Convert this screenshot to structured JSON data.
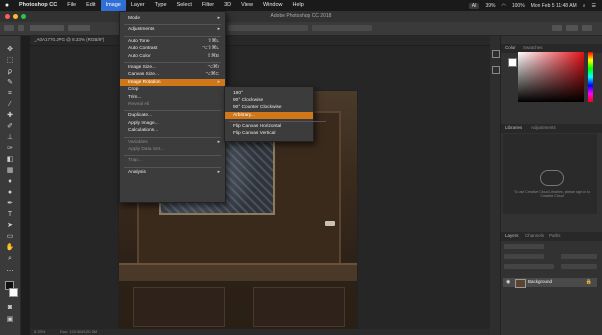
{
  "menubar": {
    "apple": "",
    "items": [
      "Photoshop CC",
      "File",
      "Edit",
      "Image",
      "Layer",
      "Type",
      "Select",
      "Filter",
      "3D",
      "View",
      "Window",
      "Help"
    ],
    "right": {
      "adobe": "AI",
      "cpu": "39%",
      "battery": "100%",
      "time": "Mon Feb 5 11:48 AM"
    }
  },
  "window": {
    "title": "Adobe Photoshop CC 2018"
  },
  "document_tab": {
    "title": "_A0A1770.JPG @ 8.33% (RGB/8*)"
  },
  "status": {
    "zoom": "8.33%",
    "doc": "Doc: 120.5M/120.5M"
  },
  "image_menu": {
    "items": [
      {
        "label": "Mode",
        "shortcut": "",
        "arrow": "▸",
        "state": "normal"
      },
      {
        "sep": true
      },
      {
        "label": "Adjustments",
        "shortcut": "",
        "arrow": "▸",
        "state": "normal"
      },
      {
        "sep": true
      },
      {
        "label": "Auto Tone",
        "shortcut": "⇧⌘L",
        "arrow": "",
        "state": "normal"
      },
      {
        "label": "Auto Contrast",
        "shortcut": "⌥⇧⌘L",
        "arrow": "",
        "state": "normal"
      },
      {
        "label": "Auto Color",
        "shortcut": "⇧⌘B",
        "arrow": "",
        "state": "normal"
      },
      {
        "sep": true
      },
      {
        "label": "Image Size...",
        "shortcut": "⌥⌘I",
        "arrow": "",
        "state": "normal"
      },
      {
        "label": "Canvas Size...",
        "shortcut": "⌥⌘C",
        "arrow": "",
        "state": "normal"
      },
      {
        "label": "Image Rotation",
        "shortcut": "",
        "arrow": "▸",
        "state": "highlighted"
      },
      {
        "label": "Crop",
        "shortcut": "",
        "arrow": "",
        "state": "normal"
      },
      {
        "label": "Trim...",
        "shortcut": "",
        "arrow": "",
        "state": "normal"
      },
      {
        "label": "Reveal All",
        "shortcut": "",
        "arrow": "",
        "state": "disabled"
      },
      {
        "sep": true
      },
      {
        "label": "Duplicate...",
        "shortcut": "",
        "arrow": "",
        "state": "normal"
      },
      {
        "label": "Apply Image...",
        "shortcut": "",
        "arrow": "",
        "state": "normal"
      },
      {
        "label": "Calculations...",
        "shortcut": "",
        "arrow": "",
        "state": "normal"
      },
      {
        "sep": true
      },
      {
        "label": "Variables",
        "shortcut": "",
        "arrow": "▸",
        "state": "disabled"
      },
      {
        "label": "Apply Data Set...",
        "shortcut": "",
        "arrow": "",
        "state": "disabled"
      },
      {
        "sep": true
      },
      {
        "label": "Trap...",
        "shortcut": "",
        "arrow": "",
        "state": "disabled"
      },
      {
        "sep": true
      },
      {
        "label": "Analysis",
        "shortcut": "",
        "arrow": "▸",
        "state": "normal"
      }
    ]
  },
  "rotation_submenu": {
    "items": [
      {
        "label": "180°",
        "state": "normal"
      },
      {
        "label": "90° Clockwise",
        "state": "normal"
      },
      {
        "label": "90° Counter Clockwise",
        "state": "normal"
      },
      {
        "label": "Arbitrary...",
        "state": "highlighted"
      },
      {
        "sep": true
      },
      {
        "label": "Flip Canvas Horizontal",
        "state": "normal"
      },
      {
        "label": "Flip Canvas Vertical",
        "state": "normal"
      }
    ]
  },
  "panels": {
    "color_tabs": [
      "Color",
      "Swatches"
    ],
    "library_tabs": [
      "Libraries",
      "Adjustments"
    ],
    "library_text": "To use Creative Cloud Libraries, please sign in to Creative Cloud",
    "layers_tabs": [
      "Layers",
      "Channels",
      "Paths"
    ],
    "layer_name": "Background"
  },
  "colors": {
    "menu_highlight": "#d0771a",
    "menubar_active": "#2f6fd6",
    "picker_hue": "#e3121a"
  }
}
